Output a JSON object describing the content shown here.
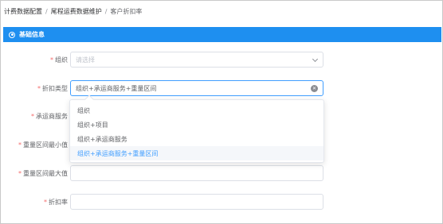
{
  "breadcrumb": {
    "items": [
      "计费数据配置",
      "尾程运费数据维护",
      "客户折扣率"
    ],
    "separator": "/"
  },
  "section": {
    "title": "基础信息",
    "color": "#1e8ff0"
  },
  "form": {
    "org": {
      "label": "组织",
      "placeholder": "请选择"
    },
    "discount_type": {
      "label": "折扣类型",
      "value": "组织+承运商服务+重量区间"
    },
    "carrier_service": {
      "label": "承运商服务",
      "value": ""
    },
    "weight_min": {
      "label": "重量区间最小值",
      "value": ""
    },
    "weight_max": {
      "label": "重量区间最大值",
      "value": ""
    },
    "discount_rate": {
      "label": "折扣率",
      "value": ""
    }
  },
  "dropdown": {
    "options": [
      "组织",
      "组织+项目",
      "组织+承运商服务",
      "组织+承运商服务+重量区间"
    ],
    "selected_index": 3
  },
  "colors": {
    "required": "#f56c6c",
    "selected_option": "#409eff",
    "focus_border": "#409eff"
  }
}
